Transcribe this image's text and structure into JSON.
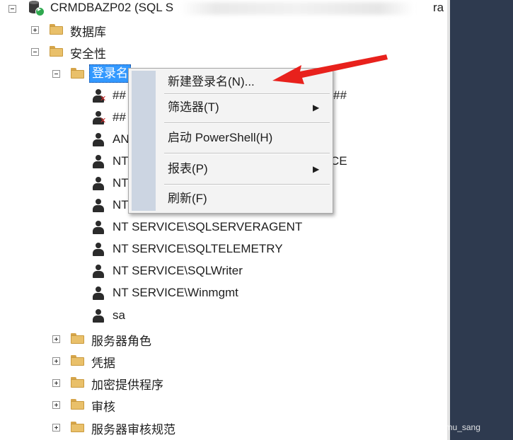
{
  "tree": {
    "server": {
      "label": "CRMDBAZP02 (SQL S",
      "label_tail": "ra"
    },
    "top_folders": [
      {
        "label": "数据库"
      },
      {
        "label": "安全性"
      }
    ],
    "logins_folder": {
      "label": "登录名"
    },
    "logins": [
      {
        "label": "##",
        "tail": "##"
      },
      {
        "label": "##",
        "tail": ""
      },
      {
        "label": "AN",
        "tail": ""
      },
      {
        "label": "NT",
        "tail": "CE"
      },
      {
        "label": "NT",
        "tail": ""
      },
      {
        "label": "NT",
        "tail": ""
      },
      {
        "label": "NT SERVICE\\SQLSERVERAGENT",
        "tail": ""
      },
      {
        "label": "NT SERVICE\\SQLTELEMETRY",
        "tail": ""
      },
      {
        "label": "NT SERVICE\\SQLWriter",
        "tail": ""
      },
      {
        "label": "NT SERVICE\\Winmgmt",
        "tail": ""
      },
      {
        "label": "sa",
        "tail": ""
      }
    ],
    "security_children": [
      {
        "label": "服务器角色"
      },
      {
        "label": "凭据"
      },
      {
        "label": "加密提供程序"
      },
      {
        "label": "审核"
      },
      {
        "label": "服务器审核规范"
      }
    ]
  },
  "context_menu": {
    "items": [
      {
        "label": "新建登录名(N)...",
        "submenu": false
      },
      {
        "label": "筛选器(T)",
        "submenu": true
      },
      {
        "label": "启动 PowerShell(H)",
        "submenu": false
      },
      {
        "label": "报表(P)",
        "submenu": true
      },
      {
        "label": "刷新(F)",
        "submenu": false
      }
    ],
    "submenu_glyph": "▶"
  },
  "watermark": "CSDN @mu_sang",
  "colors": {
    "selection": "#3399ff",
    "annotation_arrow": "#e8211c",
    "side_panel": "#2e3a4f",
    "menu_gutter": "#ccd5e2"
  }
}
